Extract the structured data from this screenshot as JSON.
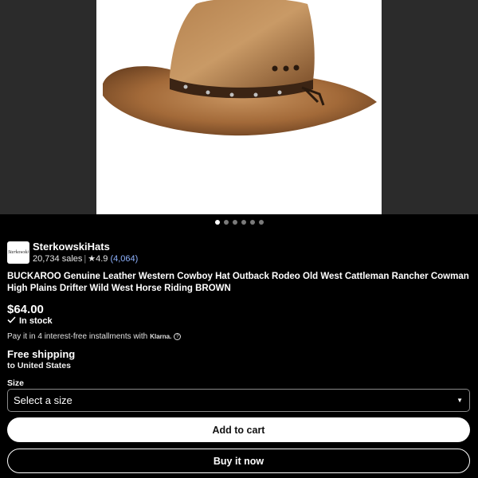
{
  "gallery": {
    "image_alt": "brown leather western cowboy hat",
    "dot_count": 6,
    "active_dot": 0
  },
  "shop": {
    "logo_text": "Sterkowski",
    "name": "SterkowskiHats",
    "sales": "20,734 sales",
    "rating": "★4.9",
    "review_count": "(4,064)"
  },
  "listing": {
    "title": "BUCKAROO Genuine Leather Western Cowboy Hat Outback Rodeo Old West Cattleman Rancher Cowman High Plains Drifter Wild West Horse Riding BROWN",
    "price": "$64.00",
    "stock": "In stock",
    "installments": "Pay it in 4 interest-free installments with",
    "installments_brand": "Klarna."
  },
  "shipping": {
    "title": "Free shipping",
    "destination": "to United States"
  },
  "size": {
    "label": "Size",
    "selected": "Select a size"
  },
  "actions": {
    "add_to_cart": "Add to cart",
    "buy_now": "Buy it now"
  },
  "colors": {
    "background": "#000000",
    "gallery_bg": "#2b2b2b",
    "link": "#8fb3ff"
  }
}
